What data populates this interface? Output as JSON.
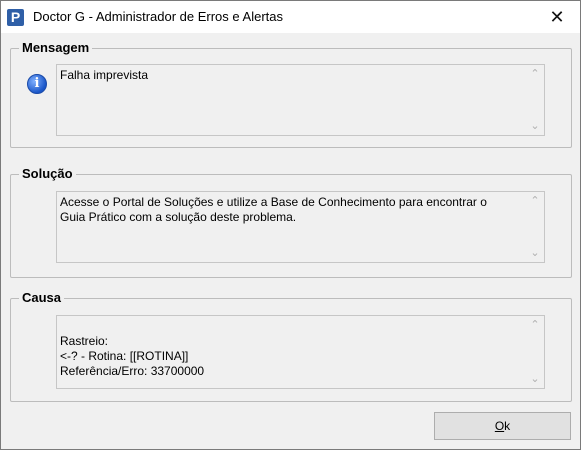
{
  "window": {
    "title": "Doctor G - Administrador de Erros e Alertas",
    "app_icon_letter": "P",
    "close_glyph": "✕"
  },
  "mensagem": {
    "legend": "Mensagem",
    "text": "Falha imprevista",
    "icon": "info-icon"
  },
  "solucao": {
    "legend": "Solução",
    "text": "Acesse o Portal de Soluções e utilize a Base de Conhecimento para encontrar o\nGuia Prático com a solução deste problema."
  },
  "causa": {
    "legend": "Causa",
    "text": "\nRastreio:\n<-? - Rotina: [[ROTINA]]\nReferência/Erro: 33700000"
  },
  "buttons": {
    "ok_mnemonic": "O",
    "ok_rest": "k"
  },
  "scroll": {
    "up_glyph": "⌃",
    "down_glyph": "⌄"
  }
}
